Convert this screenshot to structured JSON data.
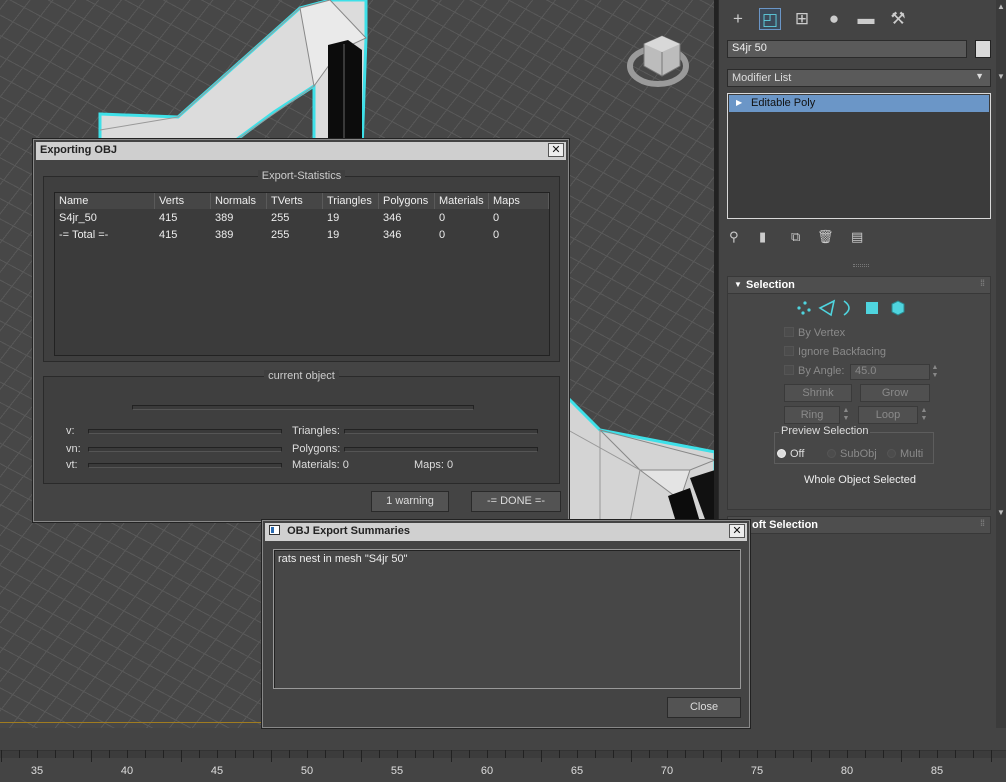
{
  "command_panel": {
    "tabs": [
      "create-icon",
      "modify-icon",
      "hierarchy-icon",
      "motion-icon",
      "display-icon",
      "utilities-icon"
    ],
    "object_name": "S4jr 50",
    "modifier_list": "Modifier List",
    "stack_item": "Editable Poly",
    "selection": {
      "title": "Selection",
      "by_vertex": "By Vertex",
      "ignore_backfacing": "Ignore Backfacing",
      "by_angle": "By Angle:",
      "angle_value": "45.0",
      "shrink": "Shrink",
      "grow": "Grow",
      "ring": "Ring",
      "loop": "Loop",
      "preview_selection": "Preview Selection",
      "preview_off": "Off",
      "preview_subobj": "SubObj",
      "preview_multi": "Multi",
      "status": "Whole Object Selected"
    },
    "soft_selection": "oft Selection"
  },
  "export_dialog": {
    "title": "Exporting OBJ",
    "stats_title": "Export-Statistics",
    "columns": [
      "Name",
      "Verts",
      "Normals",
      "TVerts",
      "Triangles",
      "Polygons",
      "Materials",
      "Maps"
    ],
    "rows": [
      [
        "S4jr_50",
        "415",
        "389",
        "255",
        "19",
        "346",
        "0",
        "0"
      ],
      [
        "-= Total =-",
        "415",
        "389",
        "255",
        "19",
        "346",
        "0",
        "0"
      ]
    ],
    "current_title": "current object",
    "v_label": "v:",
    "vn_label": "vn:",
    "vt_label": "vt:",
    "triangles_label": "Triangles:",
    "polygons_label": "Polygons:",
    "materials_label": "Materials: 0",
    "maps_label": "Maps:  0",
    "warning_button": "1 warning",
    "done_button": "-= DONE =-"
  },
  "summary_dialog": {
    "title": "OBJ Export Summaries",
    "message": "rats nest in mesh \"S4jr 50\"",
    "close_button": "Close"
  },
  "timeline": {
    "labels": [
      "35",
      "40",
      "45",
      "50",
      "55",
      "60",
      "65",
      "70",
      "75",
      "80",
      "85"
    ]
  },
  "colors": {
    "selection_highlight": "#6b96c7",
    "wire_cyan": "#3ee0e8",
    "panel_bg": "#444444"
  }
}
